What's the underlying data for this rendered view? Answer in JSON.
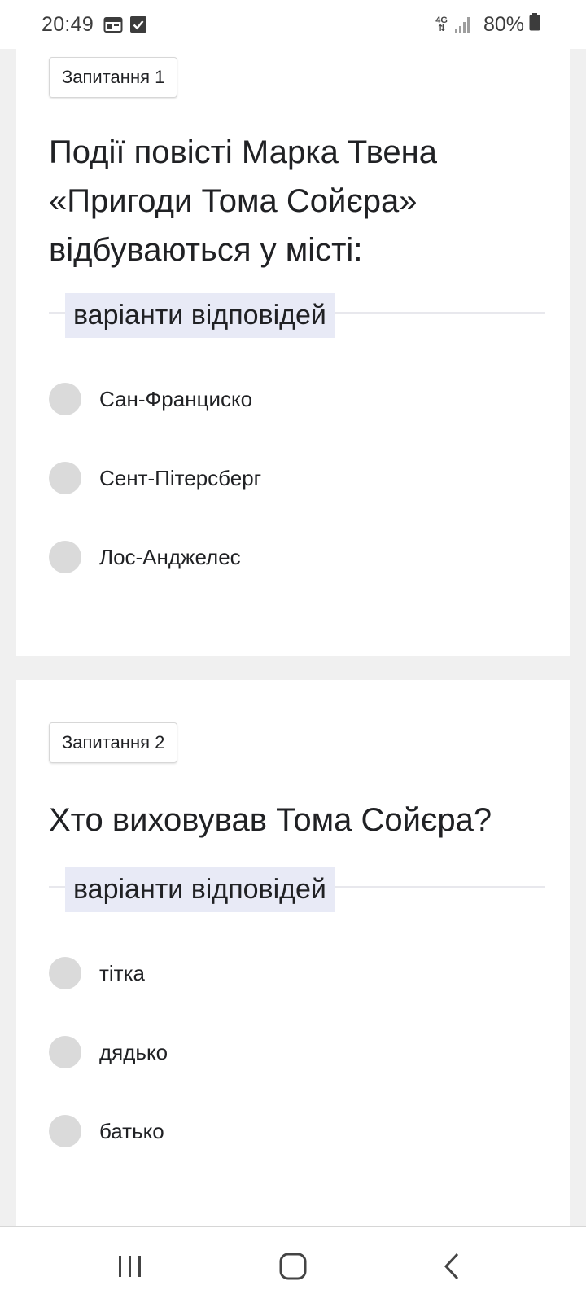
{
  "status_bar": {
    "time": "20:49",
    "network": "4G",
    "battery": "80%",
    "icons": [
      "calendar-icon",
      "check-box-icon",
      "data-arrows-icon",
      "signal-icon",
      "battery-icon"
    ]
  },
  "questions": [
    {
      "chip": "Запитання 1",
      "text": "Події повісті Марка Твена «Пригоди Тома Сойєра» відбуваються у місті:",
      "section_label": "варіанти відповідей",
      "options": [
        "Сан-Франциско",
        "Сент-Пітерсберг",
        "Лос-Анджелес"
      ]
    },
    {
      "chip": "Запитання 2",
      "text": "Хто виховував Тома Сойєра?",
      "section_label": "варіанти відповідей",
      "options": [
        "тітка",
        "дядько",
        "батько"
      ]
    }
  ],
  "nav_bar": {
    "buttons": [
      "recent-apps-icon",
      "home-icon",
      "back-icon"
    ]
  },
  "colors": {
    "background": "#f0f0f0",
    "card": "#ffffff",
    "section_label_bg": "#e8eaf6",
    "radio": "#dadada",
    "text": "#202124"
  }
}
